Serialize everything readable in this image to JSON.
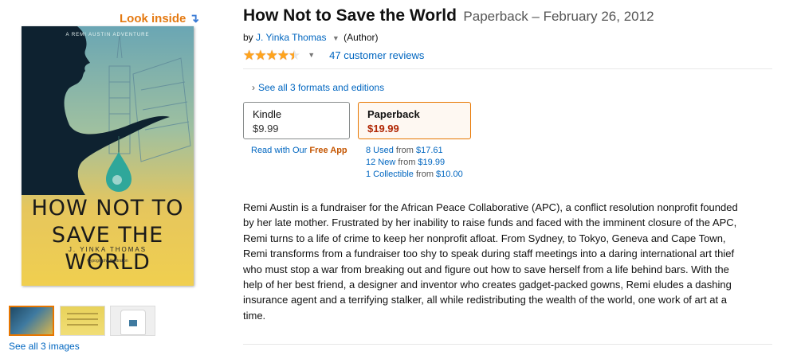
{
  "left": {
    "look_inside": "Look inside",
    "look_inside_arrow": "↴",
    "cover": {
      "series": "A REMI AUSTIN ADVENTURE",
      "title_line1": "HOW NOT TO",
      "title_line2": "SAVE THE WORLD",
      "author": "J. YINKA THOMAS",
      "credit": "Cypographe Illustration"
    },
    "see_images": "See all 3 images"
  },
  "product": {
    "title": "How Not to Save the World",
    "format_date": "Paperback – February 26, 2012",
    "by_prefix": "by",
    "author": "J. Yinka Thomas",
    "author_caret": "▼",
    "author_role": "(Author)",
    "rating_fraction": 0.9,
    "rating_caret": "▼",
    "reviews": "47 customer reviews"
  },
  "formats": {
    "see_all": "See all 3 formats and editions",
    "kindle": {
      "name": "Kindle",
      "price": "$9.99"
    },
    "paperback": {
      "name": "Paperback",
      "price": "$19.99"
    },
    "kindle_app_prefix": "Read with Our",
    "kindle_app_bold": "Free App",
    "offers": [
      {
        "link": "8 Used",
        "from": "from",
        "price": "$17.61"
      },
      {
        "link": "12 New",
        "from": "from",
        "price": "$19.99"
      },
      {
        "link": "1 Collectible",
        "from": "from",
        "price": "$10.00"
      }
    ]
  },
  "description": "Remi Austin is a fundraiser for the African Peace Collaborative (APC), a conflict resolution nonprofit founded by her late mother. Frustrated by her inability to raise funds and faced with the imminent closure of the APC, Remi turns to a life of crime to keep her nonprofit afloat. From Sydney, to Tokyo, Geneva and Cape Town, Remi transforms from a fundraiser too shy to speak during staff meetings into a daring international art thief who must stop a war from breaking out and figure out how to save herself from a life behind bars. With the help of her best friend, a designer and inventor who creates gadget-packed gowns, Remi eludes a dashing insurance agent and a terrifying stalker, all while redistributing the wealth of the world, one work of art at a time.",
  "colors": {
    "link": "#0066c0",
    "price": "#b12704",
    "look_inside": "#e47911",
    "star": "#ffa41c",
    "selected_border": "#e77600"
  }
}
